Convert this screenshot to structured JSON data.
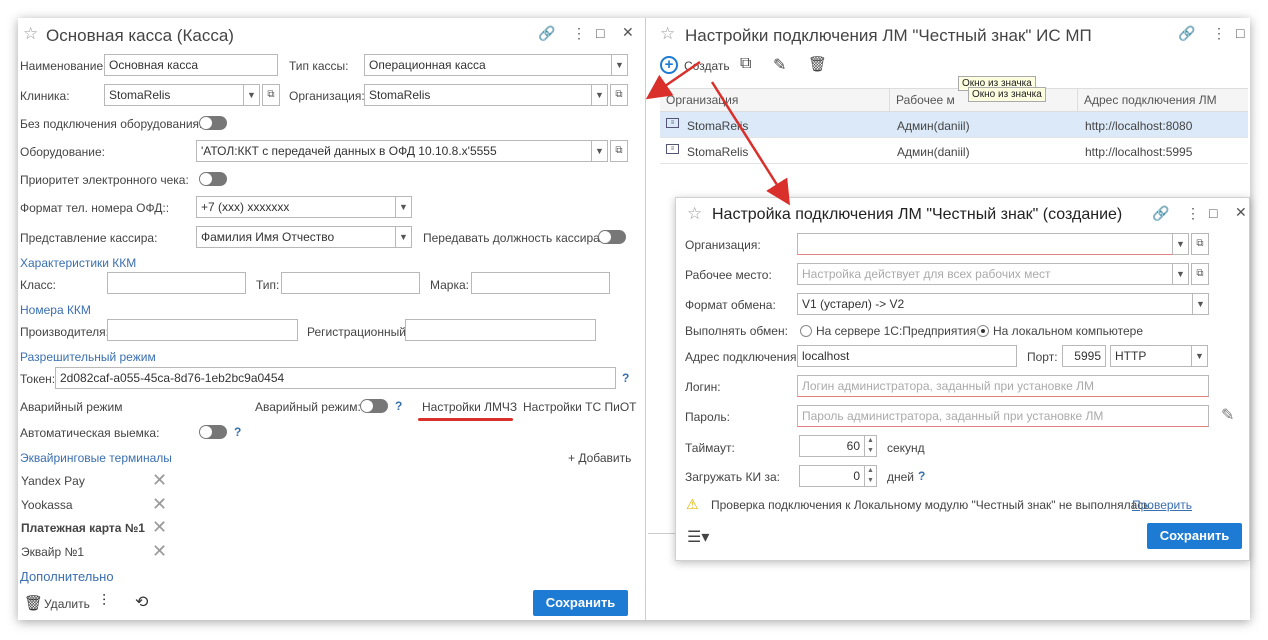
{
  "left": {
    "title": "Основная касса (Касса)",
    "name_label": "Наименование:",
    "name_value": "Основная касса",
    "type_label": "Тип кассы:",
    "type_value": "Операционная касса",
    "clinic_label": "Клиника:",
    "clinic_value": "StomaRelis",
    "org_label": "Организация:",
    "org_value": "StomaRelis",
    "noequip_label": "Без подключения оборудования:",
    "equip_label": "Оборудование:",
    "equip_value": "'АТОЛ:ККТ с передачей данных в ОФД 10.10.8.x'5555",
    "prio_label": "Приоритет электронного чека:",
    "phone_label": "Формат тел. номера ОФД::",
    "phone_value": "+7 (xxx) xxxxxxx",
    "cashier_label": "Представление кассира:",
    "cashier_value": "Фамилия Имя Отчество",
    "pass_pos_label": "Передавать должность кассира:",
    "kkm_chars": "Характеристики ККМ",
    "class_label": "Класс:",
    "type2_label": "Тип:",
    "brand_label": "Марка:",
    "kkm_numbers": "Номера ККМ",
    "manuf_label": "Производителя:",
    "reg_label": "Регистрационный:",
    "permit": "Разрешительный режим",
    "token_label": "Токен:",
    "token_value": "2d082caf-a055-45ca-8d76-1eb2bc9a0454",
    "emerg_title": "Аварийный режим",
    "emerg_label": "Аварийный режим:",
    "lmchz": "Настройки ЛМЧЗ",
    "tspiot": "Настройки ТС ПиОТ",
    "auto_label": "Автоматическая выемка:",
    "acq_title": "Эквайринговые терминалы",
    "add": "+ Добавить",
    "terminals": [
      "Yandex Pay",
      "Yookassa",
      "Платежная карта №1",
      "Эквайр №1"
    ],
    "more": "Дополнительно",
    "delete": "Удалить",
    "save": "Сохранить"
  },
  "right": {
    "title": "Настройки подключения ЛМ \"Честный знак\" ИС МП",
    "create": "Создать",
    "tooltip": "Окно из значка",
    "columns": [
      "Организация",
      "Рабочее м",
      "Адрес подключения ЛМ"
    ],
    "rows": [
      {
        "org": "StomaRelis",
        "ws": "Админ(daniil)",
        "addr": "http://localhost:8080"
      },
      {
        "org": "StomaRelis",
        "ws": "Админ(daniil)",
        "addr": "http://localhost:5995"
      }
    ]
  },
  "dialog": {
    "title": "Настройка подключения ЛМ \"Честный знак\" (создание)",
    "org_label": "Организация:",
    "ws_label": "Рабочее место:",
    "ws_placeholder": "Настройка действует для всех рабочих мест",
    "fmt_label": "Формат обмена:",
    "fmt_value": "V1 (устарел) -> V2",
    "exec_label": "Выполнять обмен:",
    "opt_server": "На сервере 1С:Предприятия",
    "opt_local": "На локальном компьютере",
    "addr_label": "Адрес подключения:",
    "addr_value": "localhost",
    "port_label": "Порт:",
    "port_value": "5995",
    "proto_value": "HTTP",
    "login_label": "Логин:",
    "login_placeholder": "Логин администратора, заданный при установке ЛМ",
    "pass_label": "Пароль:",
    "pass_placeholder": "Пароль администратора, заданный при установке ЛМ",
    "timeout_label": "Таймаут:",
    "timeout_value": "60",
    "timeout_unit": "секунд",
    "load_label": "Загружать КИ за:",
    "load_value": "0",
    "load_unit": "дней",
    "warning": "Проверка подключения к Локальному модулю \"Честный знак\" не выполнялась.",
    "check": "Проверить",
    "save": "Сохранить"
  },
  "colors": {
    "accent": "#1e7bd3",
    "link": "#3a6fb0",
    "annotation": "#d9302b"
  }
}
